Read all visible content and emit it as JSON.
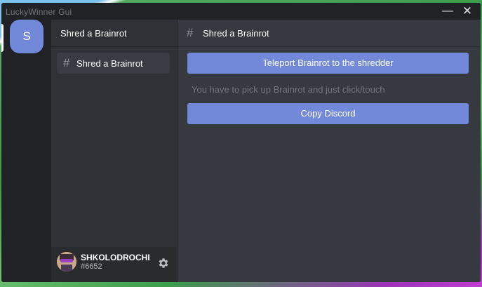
{
  "window": {
    "title": "LuckyWinner Gui",
    "minimize": "—",
    "close": "✕"
  },
  "guild": {
    "initial": "S"
  },
  "sidebar": {
    "header": "Shred a Brainrot",
    "channels": [
      {
        "label": "Shred a Brainrot"
      }
    ]
  },
  "user": {
    "name": "SHKOLODROCHER",
    "discriminator": "#6652"
  },
  "main": {
    "title": "Shred a Brainrot",
    "teleport_button": "Teleport Brainrot to the shredder",
    "hint": "You have to pick up Brainrot and just click/touch",
    "discord_button": "Copy Discord"
  },
  "colors": {
    "accent": "#7289da",
    "bg_main": "#36393f",
    "bg_side": "#2f3136",
    "bg_rail": "#202225"
  },
  "icons": {
    "channel": "hash-icon",
    "settings": "gear-icon"
  }
}
